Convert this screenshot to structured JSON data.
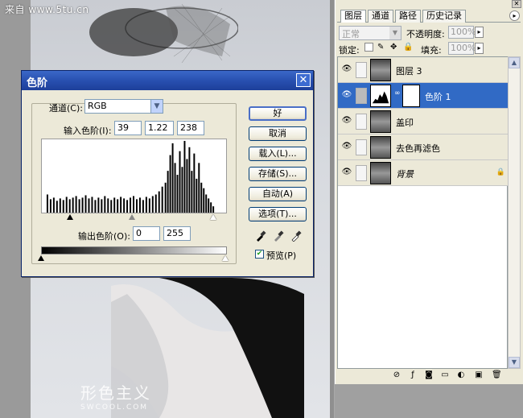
{
  "watermark_top": "来自 www.5tu.cn",
  "watermark_logo": {
    "line1": "形色主义",
    "line2": "SWCOOL.COM"
  },
  "levels_dialog": {
    "title": "色阶",
    "close_glyph": "✕",
    "channel_label": "通道(C):",
    "channel_value": "RGB",
    "input_levels_label": "输入色阶(I):",
    "input_black": "39",
    "input_gamma": "1.22",
    "input_white": "238",
    "output_levels_label": "输出色阶(O):",
    "output_black": "0",
    "output_white": "255",
    "buttons": {
      "ok": "好",
      "cancel": "取消",
      "load": "载入(L)...",
      "save": "存储(S)...",
      "auto": "自动(A)",
      "options": "选项(T)..."
    },
    "preview_label": "预览(P)",
    "preview_checked": true
  },
  "layers_panel": {
    "tabs": [
      "图层",
      "通道",
      "路径",
      "历史记录"
    ],
    "active_tab": 0,
    "blend_mode": "正常",
    "opacity_label": "不透明度:",
    "opacity_value": "100%",
    "lock_label": "锁定:",
    "fill_label": "填充:",
    "fill_value": "100%",
    "layers": [
      {
        "name": "图层 3",
        "selected": false
      },
      {
        "name": "色阶 1",
        "selected": true
      },
      {
        "name": "盖印",
        "selected": false
      },
      {
        "name": "去色再滤色",
        "selected": false
      },
      {
        "name": "背景",
        "selected": false,
        "locked": true
      }
    ]
  },
  "colors": {
    "title_bar": "#2850b0",
    "selection": "#316ac5",
    "dialog_bg": "#ece9d8"
  }
}
